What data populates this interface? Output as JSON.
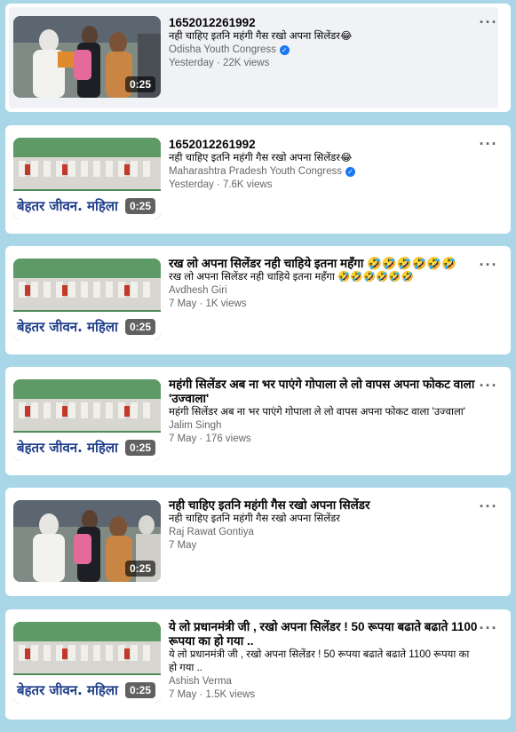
{
  "videos": [
    {
      "title": "1652012261992",
      "description": "नही चाहिए इतनि महंगी गैस रखो अपना सिलेंडर😂",
      "channel": "Odisha Youth Congress",
      "verified": true,
      "meta": "Yesterday · 22K views",
      "duration": "0:25",
      "thumbnail": "closeup-handover"
    },
    {
      "title": "1652012261992",
      "description": "नही चाहिए इतनि महंगी गैस रखो अपना सिलेंडर😂",
      "channel": "Maharashtra Pradesh Youth Congress",
      "verified": true,
      "meta": "Yesterday · 7.6K views",
      "duration": "0:25",
      "thumbnail": "stage-banner",
      "banner_text": "बेहतर जीवन. महिला"
    },
    {
      "title": "रख लो अपना सिलेंडर नही चाहिये इतना महँगा 🤣🤣🤣🤣🤣🤣",
      "description": "रख लो अपना सिलेंडर नही चाहिये इतना महँगा 🤣🤣🤣🤣🤣🤣",
      "channel": "Avdhesh Giri",
      "verified": false,
      "meta": "7 May · 1K views",
      "duration": "0:25",
      "thumbnail": "stage-banner",
      "banner_text": "बेहतर जीवन. महिला"
    },
    {
      "title": "महंगी सिलेंडर अब ना भर पाएंगे गोपाला ले लो वापस अपना फोकट वाला 'उज्वाला'",
      "description": "महंगी सिलेंडर अब ना भर पाएंगे गोपाला ले लो वापस अपना फोकट वाला 'उज्वाला'",
      "channel": "Jalim Singh",
      "verified": false,
      "meta": "7 May · 176 views",
      "duration": "0:25",
      "thumbnail": "stage-banner",
      "banner_text": "बेहतर जीवन. महिला"
    },
    {
      "title": "नही चाहिए इतनि महंगी गैस रखो अपना सिलेंडर",
      "description": "नही चाहिए इतनि महंगी गैस रखो अपना सिलेंडर",
      "channel": "Raj Rawat Gontiya",
      "verified": false,
      "meta": "7 May",
      "duration": "0:25",
      "thumbnail": "closeup-handover"
    },
    {
      "title": "ये लो प्रधानमंत्री जी , रखो अपना सिलेंडर ! 50 रूपया बढाते बढाते 1100 रूपया का हो गया ..",
      "description": "ये लो प्रधानमंत्री जी , रखो अपना सिलेंडर ! 50 रूपया बढाते बढाते 1100 रूपया का हो गया ..",
      "channel": "Ashish Verma",
      "verified": false,
      "meta": "7 May · 1.5K views",
      "duration": "0:25",
      "thumbnail": "stage-banner",
      "banner_text": "बेहतर जीवन. महिला"
    }
  ],
  "icons": {
    "more": "more-options-icon",
    "verified": "verified-badge-icon"
  },
  "colors": {
    "page_background": "#a9d7e8",
    "card_background": "#ffffff",
    "highlight_background": "#f0f2f5",
    "secondary_text": "#65676b",
    "verified_blue": "#1877f2"
  }
}
